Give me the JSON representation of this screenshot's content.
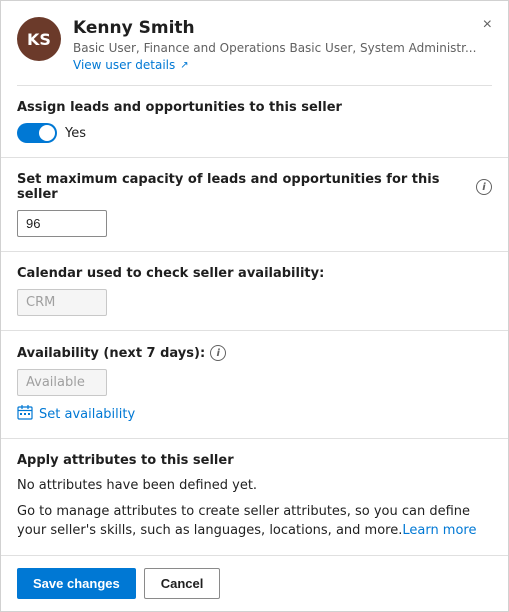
{
  "header": {
    "avatar_initials": "KS",
    "name": "Kenny Smith",
    "roles": "Basic User, Finance and Operations Basic User, System Administr...",
    "view_user_details_label": "View user details",
    "close_label": "×"
  },
  "sections": {
    "assign_leads": {
      "label": "Assign leads and opportunities to this seller",
      "toggle_value": true,
      "toggle_display": "Yes"
    },
    "max_capacity": {
      "label": "Set maximum capacity of leads and opportunities for this seller",
      "value": "96"
    },
    "calendar": {
      "label": "Calendar used to check seller availability:",
      "value": "CRM"
    },
    "availability": {
      "label": "Availability (next 7 days):",
      "value": "Available",
      "set_availability_label": "Set availability"
    },
    "attributes": {
      "label": "Apply attributes to this seller",
      "no_attributes_text": "No attributes have been defined yet.",
      "description": "Go to manage attributes to create seller attributes, so you can define your seller's skills, such as languages, locations, and more.",
      "learn_more_label": "Learn more",
      "learn_more_url": "#"
    }
  },
  "footer": {
    "save_label": "Save changes",
    "cancel_label": "Cancel"
  }
}
